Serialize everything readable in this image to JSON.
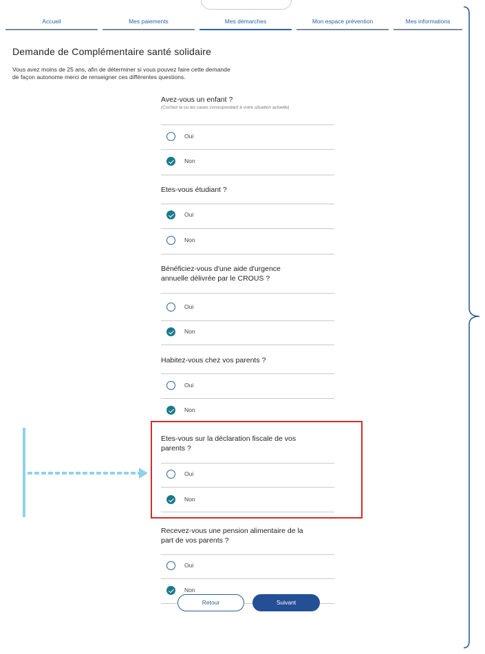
{
  "header": {
    "tabs": [
      {
        "label": "Accueil",
        "active": false
      },
      {
        "label": "Mes paiements",
        "active": false
      },
      {
        "label": "Mes démarches",
        "active": true
      },
      {
        "label": "Mon espace prévention",
        "active": false
      },
      {
        "label": "Mes informations",
        "active": false
      }
    ]
  },
  "page": {
    "title": "Demande de Complémentaire santé solidaire",
    "intro_line1": "Vous avez moins de 25 ans, afin de déterminer si vous pouvez faire cette demande",
    "intro_line2": "de façon autonome merci de renseigner ces différentes questions."
  },
  "questions": [
    {
      "title": "Avez-vous un enfant ?",
      "hint": "(Cochez la ou les cases correspondant à votre situation actuelle)",
      "selected": "Non"
    },
    {
      "title": "Etes-vous étudiant ?",
      "selected": "Oui"
    },
    {
      "title_line1": "Bénéficiez-vous d'une aide d'urgence",
      "title_line2": "annuelle délivrée par le CROUS ?",
      "selected": "Non"
    },
    {
      "title": "Habitez-vous chez vos parents ?",
      "selected": "Non"
    },
    {
      "title_line1": "Etes-vous sur la déclaration fiscale de vos",
      "title_line2": "parents ?",
      "selected": "Non"
    },
    {
      "title_line1": "Recevez-vous une pension alimentaire de la",
      "title_line2": "part de vos parents ?",
      "selected": "Non"
    }
  ],
  "options": {
    "yes": "Oui",
    "no": "Non"
  },
  "buttons": {
    "back": "Retour",
    "next": "Suivant"
  },
  "colors": {
    "accent": "#2a63a8",
    "checked": "#1b7a8b",
    "highlight": "#d42b2b",
    "arrow": "#8ed3e8",
    "primary_button": "#244f95"
  }
}
